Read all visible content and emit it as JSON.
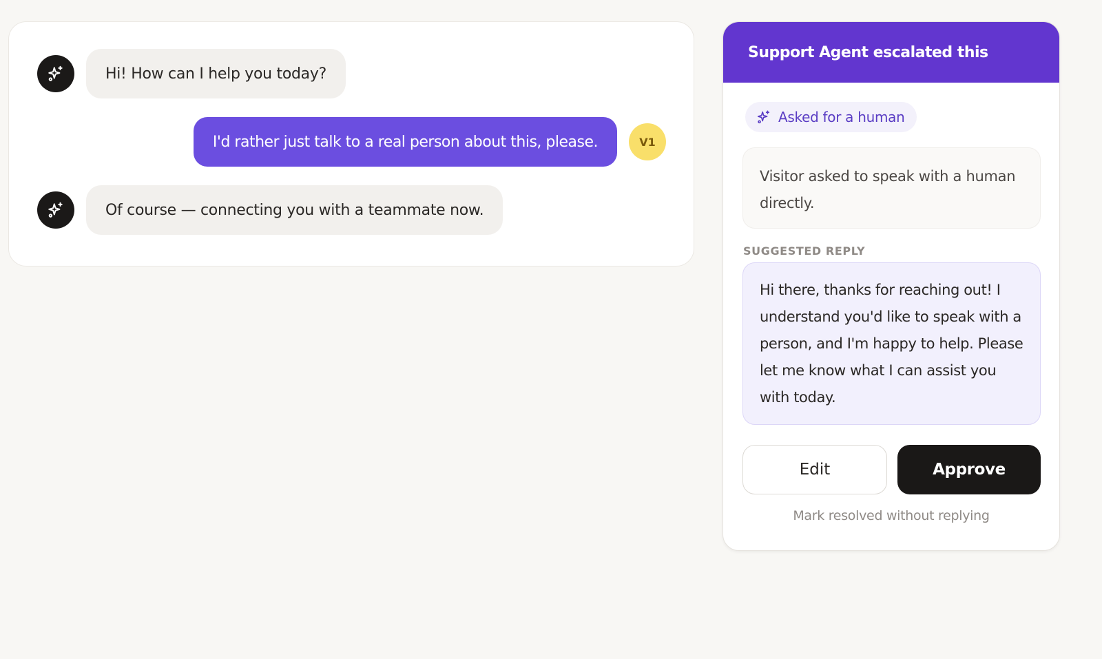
{
  "conversation": {
    "messages": [
      {
        "sender": "bot",
        "text": "Hi! How can I help you today?"
      },
      {
        "sender": "user",
        "text": "I'd rather just talk to a real person about this, please.",
        "avatar_initials": "V1"
      },
      {
        "sender": "bot",
        "text": "Of course — connecting you with a teammate now."
      }
    ]
  },
  "escalation_panel": {
    "title": "Support Agent escalated this",
    "reason_chip": "Asked for a human",
    "reason_detail": "Visitor asked to speak with a human directly.",
    "suggested_label": "SUGGESTED REPLY",
    "suggested_reply": "Hi there, thanks for reaching out! I understand you'd like to speak with a person, and I'm happy to help. Please let me know what I can assist you with today.",
    "edit_label": "Edit",
    "approve_label": "Approve",
    "resolve_link": "Mark resolved without replying"
  },
  "icons": {
    "bot_avatar": "sparkles-icon",
    "reason_chip": "sparkles-icon"
  },
  "colors": {
    "accent": "#6b4ee0",
    "header": "#6236cf",
    "user_avatar": "#f9df6a",
    "approve": "#1a1817"
  }
}
